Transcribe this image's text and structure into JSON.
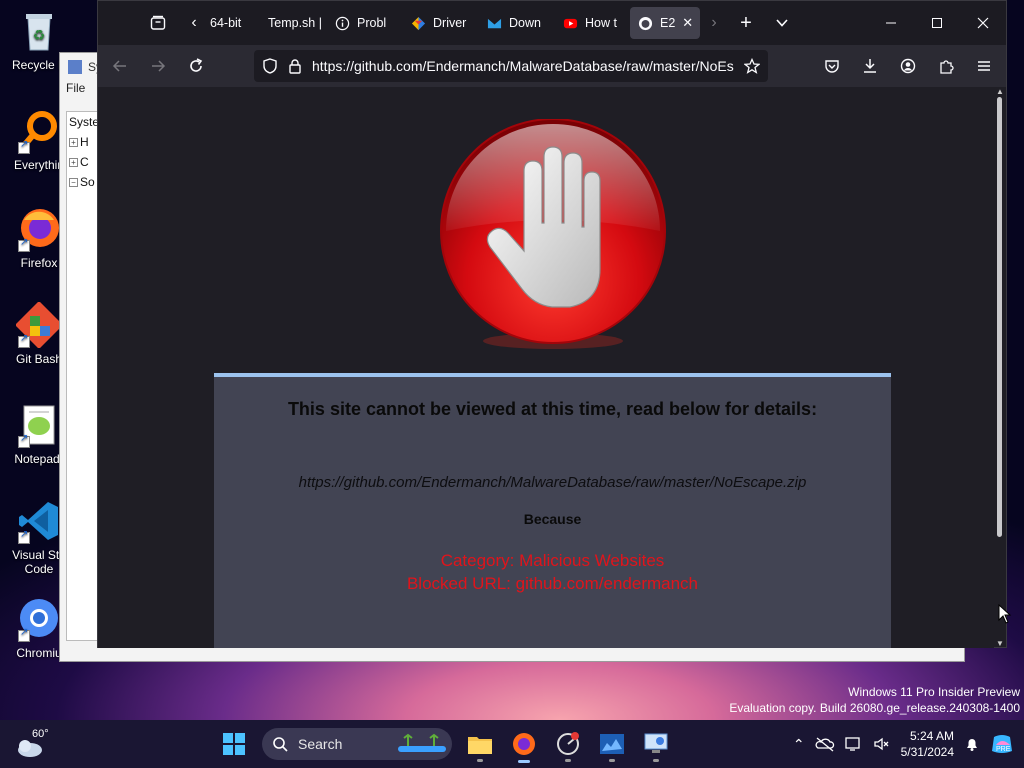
{
  "desktop": {
    "icons": [
      {
        "label": "Recycle B"
      },
      {
        "label": "Everythin"
      },
      {
        "label": "Firefox"
      },
      {
        "label": "Git Bash"
      },
      {
        "label": "Notepad-"
      },
      {
        "label": "Visual Stu Code"
      },
      {
        "label": "Chromiu"
      }
    ]
  },
  "bg_window": {
    "title": "Sy",
    "menu": "File",
    "tree": [
      "Syste",
      "H",
      "C",
      "So"
    ]
  },
  "browser": {
    "tabs": [
      {
        "label": "64-bit",
        "icon": "none"
      },
      {
        "label": "Temp.sh |",
        "icon": "none"
      },
      {
        "label": "Probl",
        "icon": "info-icon"
      },
      {
        "label": "Driver",
        "icon": "colorful-logo-icon"
      },
      {
        "label": "Down",
        "icon": "blue-logo-icon"
      },
      {
        "label": "How t",
        "icon": "youtube-icon"
      },
      {
        "label": "E2",
        "icon": "github-icon",
        "active": true
      }
    ],
    "url": "https://github.com/Endermanch/MalwareDatabase/raw/master/NoEscape.zip",
    "block_page": {
      "headline": "This site cannot be viewed at this time, read below for details:",
      "blocked_url": "https://github.com/Endermanch/MalwareDatabase/raw/master/NoEscape.zip",
      "because": "Because",
      "category": "Category: Malicious Websites",
      "blocked": "Blocked URL: github.com/endermanch"
    }
  },
  "watermark": {
    "line1": "Windows 11 Pro Insider Preview",
    "line2": "Evaluation copy. Build 26080.ge_release.240308-1400"
  },
  "taskbar": {
    "weather_temp": "60°",
    "search_placeholder": "Search",
    "clock_time": "5:24 AM",
    "clock_date": "5/31/2024",
    "accent": "#9ac9ff"
  }
}
